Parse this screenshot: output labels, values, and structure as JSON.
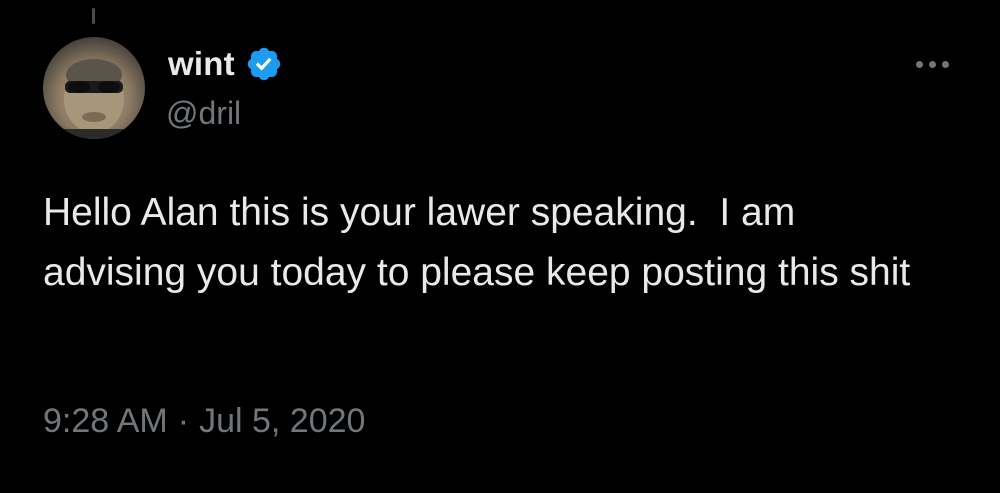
{
  "tweet": {
    "author": {
      "display_name": "wint",
      "handle": "@dril",
      "verified": true,
      "avatar_icon": "user-avatar"
    },
    "text": "Hello Alan this is your lawer speaking.  I am advising you today to please keep posting this shit",
    "time": "9:28 AM",
    "separator": "·",
    "date": "Jul 5, 2020",
    "more_icon": "more-options-icon"
  },
  "colors": {
    "background": "#000000",
    "text": "#e7e9ea",
    "secondary_text": "#71767b",
    "verified_badge": "#1d9bf0"
  }
}
